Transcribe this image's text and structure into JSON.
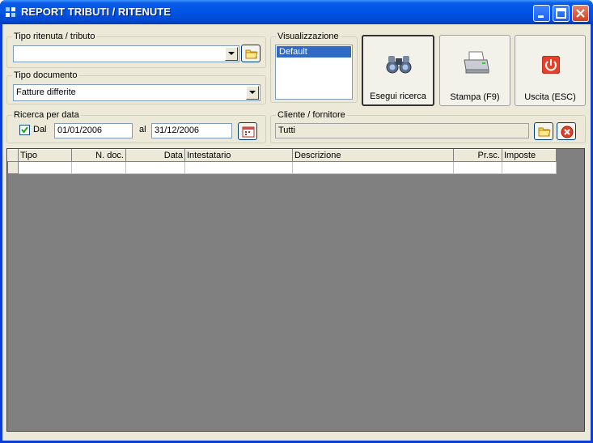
{
  "window": {
    "title": "REPORT TRIBUTI / RITENUTE"
  },
  "tipo_ritenuta": {
    "label": "Tipo ritenuta / tributo",
    "value": ""
  },
  "tipo_documento": {
    "label": "Tipo documento",
    "value": "Fatture differite"
  },
  "visualizzazione": {
    "label": "Visualizzazione",
    "items": [
      "Default"
    ]
  },
  "buttons": {
    "esegui": "Esegui ricerca",
    "stampa": "Stampa (F9)",
    "uscita": "Uscita (ESC)"
  },
  "ricerca_data": {
    "label": "Ricerca per data",
    "checkbox_label": "Dal",
    "checked": true,
    "from": "01/01/2006",
    "to_label": "al",
    "to": "31/12/2006"
  },
  "cliente": {
    "label": "Cliente / fornitore",
    "value": "Tutti"
  },
  "grid": {
    "columns": [
      "Tipo",
      "N. doc.",
      "Data",
      "Intestatario",
      "Descrizione",
      "Pr.sc.",
      "Imposte"
    ]
  },
  "colors": {
    "titlebar": "#0054e3",
    "grid_background": "#808080",
    "selection": "#316ac5"
  }
}
